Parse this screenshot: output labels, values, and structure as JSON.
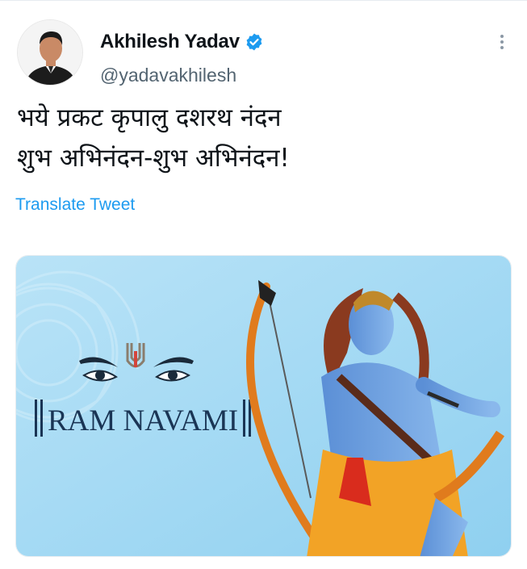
{
  "tweet": {
    "author": {
      "display_name": "Akhilesh Yadav",
      "handle": "@yadavakhilesh",
      "verified": true,
      "avatar_icon": "profile-photo"
    },
    "text_lines": [
      "भये प्रकट कृपालु दशरथ नंदन",
      "शुभ अभिनंदन-शुभ अभिनंदन!"
    ],
    "translate_label": "Translate Tweet",
    "media": {
      "caption_text": "RAM NAVAMI",
      "background_color": "#a8d9f2"
    },
    "more_icon": "more-options-icon"
  },
  "colors": {
    "accent": "#1d9bf0",
    "text": "#0f1419",
    "secondary": "#536471"
  }
}
